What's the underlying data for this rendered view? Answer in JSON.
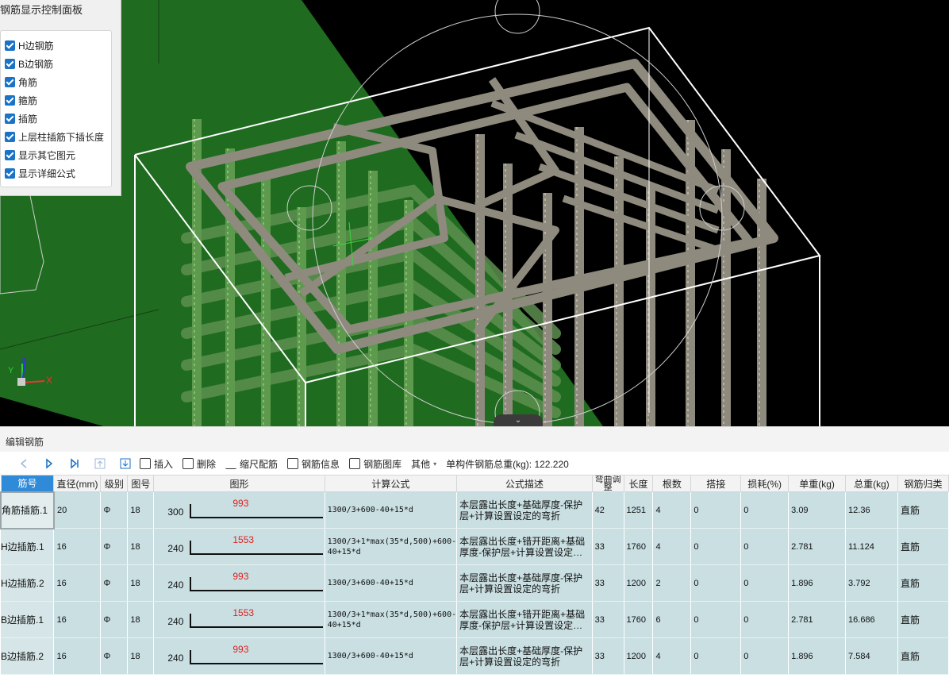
{
  "panel": {
    "title": "钢筋显示控制面板",
    "options": [
      {
        "label": "H边钢筋",
        "checked": true
      },
      {
        "label": "B边钢筋",
        "checked": true
      },
      {
        "label": "角筋",
        "checked": true
      },
      {
        "label": "箍筋",
        "checked": true
      },
      {
        "label": "插筋",
        "checked": true
      },
      {
        "label": "上层柱插筋下插长度",
        "checked": true
      },
      {
        "label": "显示其它图元",
        "checked": true
      },
      {
        "label": "显示详细公式",
        "checked": true
      }
    ]
  },
  "viewport": {
    "axis_labels": {
      "x": "X",
      "y": "Y",
      "z": "Z"
    },
    "collapse_icon": "chevron-down-icon",
    "colors": {
      "background": "#000000",
      "plane": "#1f6b1f",
      "rebar": "#8e8a7e",
      "box": "#ffffff"
    }
  },
  "editor": {
    "title": "编辑钢筋",
    "toolbar": {
      "insert": "插入",
      "delete": "删除",
      "scale": "缩尺配筋",
      "info": "钢筋信息",
      "library": "钢筋图库",
      "other": "其他",
      "total_weight": "单构件钢筋总重(kg): 122.220"
    },
    "columns": [
      "筋号",
      "直径(mm)",
      "级别",
      "图号",
      "图形",
      "计算公式",
      "公式描述",
      "弯曲调整",
      "长度",
      "根数",
      "搭接",
      "损耗(%)",
      "单重(kg)",
      "总重(kg)",
      "钢筋归类"
    ],
    "rows": [
      {
        "name": "角筋插筋.1",
        "dia": "20",
        "grade": "Φ",
        "fig": "18",
        "s1": "300",
        "s2": "993",
        "formula": "1300/3+600-40+15*d",
        "desc": "本层露出长度+基础厚度-保护层+计算设置设定的弯折",
        "bend": "42",
        "length": "1251",
        "count": "4",
        "lap": "0",
        "loss": "0",
        "unit": "3.09",
        "total": "12.36",
        "type": "直筋"
      },
      {
        "name": "H边插筋.1",
        "dia": "16",
        "grade": "Φ",
        "fig": "18",
        "s1": "240",
        "s2": "1553",
        "formula": "1300/3+1*max(35*d,500)+600-40+15*d",
        "desc": "本层露出长度+错开距离+基础厚度-保护层+计算设置设定…",
        "bend": "33",
        "length": "1760",
        "count": "4",
        "lap": "0",
        "loss": "0",
        "unit": "2.781",
        "total": "11.124",
        "type": "直筋"
      },
      {
        "name": "H边插筋.2",
        "dia": "16",
        "grade": "Φ",
        "fig": "18",
        "s1": "240",
        "s2": "993",
        "formula": "1300/3+600-40+15*d",
        "desc": "本层露出长度+基础厚度-保护层+计算设置设定的弯折",
        "bend": "33",
        "length": "1200",
        "count": "2",
        "lap": "0",
        "loss": "0",
        "unit": "1.896",
        "total": "3.792",
        "type": "直筋"
      },
      {
        "name": "B边插筋.1",
        "dia": "16",
        "grade": "Φ",
        "fig": "18",
        "s1": "240",
        "s2": "1553",
        "formula": "1300/3+1*max(35*d,500)+600-40+15*d",
        "desc": "本层露出长度+错开距离+基础厚度-保护层+计算设置设定…",
        "bend": "33",
        "length": "1760",
        "count": "6",
        "lap": "0",
        "loss": "0",
        "unit": "2.781",
        "total": "16.686",
        "type": "直筋"
      },
      {
        "name": "B边插筋.2",
        "dia": "16",
        "grade": "Φ",
        "fig": "18",
        "s1": "240",
        "s2": "993",
        "formula": "1300/3+600-40+15*d",
        "desc": "本层露出长度+基础厚度-保护层+计算设置设定的弯折",
        "bend": "33",
        "length": "1200",
        "count": "4",
        "lap": "0",
        "loss": "0",
        "unit": "1.896",
        "total": "7.584",
        "type": "直筋"
      }
    ]
  }
}
